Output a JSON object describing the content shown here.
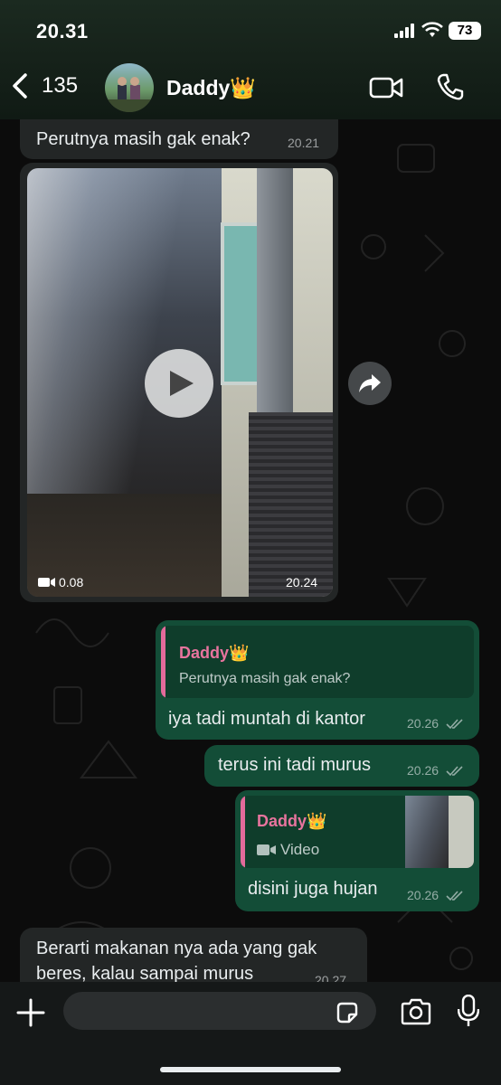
{
  "status_bar": {
    "time": "20.31",
    "battery": "73"
  },
  "header": {
    "back_count": "135",
    "contact_name": "Daddy👑"
  },
  "messages": [
    {
      "type": "in",
      "text": "Perutnya masih gak enak?",
      "time": "20.21"
    },
    {
      "type": "in-video",
      "duration": "0.08",
      "time": "20.24"
    },
    {
      "type": "out-reply",
      "quote_name": "Daddy👑",
      "quote_text": "Perutnya masih gak enak?",
      "text": "iya tadi muntah di kantor",
      "time": "20.26"
    },
    {
      "type": "out",
      "text": "terus ini tadi murus",
      "time": "20.26"
    },
    {
      "type": "out-reply-video",
      "quote_name": "Daddy👑",
      "quote_text": "Video",
      "text": "disini juga hujan",
      "time": "20.26"
    },
    {
      "type": "in",
      "text_line1": "Berarti makanan nya ada yang gak",
      "text_line2": "beres, kalau sampai murus",
      "time": "20.27"
    }
  ],
  "colors": {
    "incoming": "#232626",
    "outgoing": "#134d37",
    "quote_accent": "#e36a9b"
  },
  "icons": [
    "back-chevron-icon",
    "video-call-icon",
    "phone-icon",
    "play-icon",
    "forward-icon",
    "plus-icon",
    "sticker-icon",
    "camera-icon",
    "mic-icon",
    "double-check-icon",
    "video-camera-icon"
  ]
}
